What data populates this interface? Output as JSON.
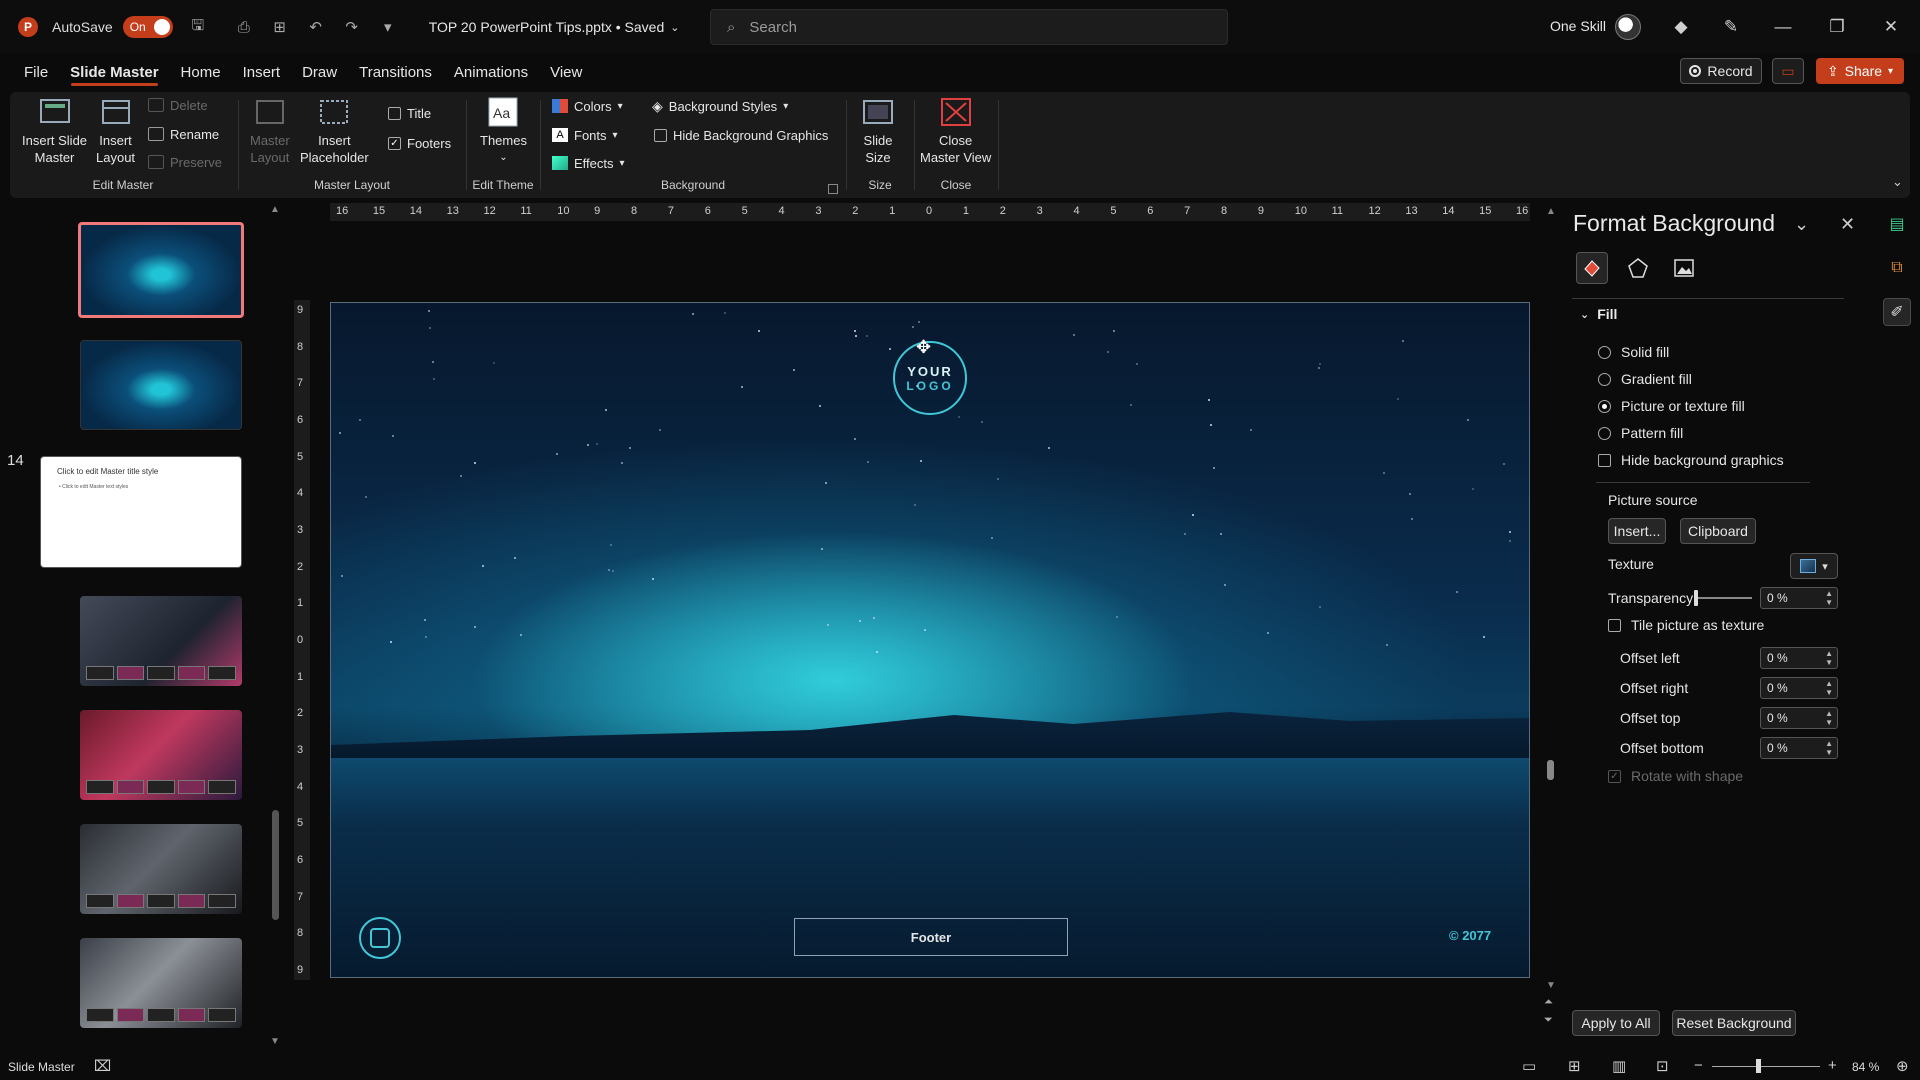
{
  "titlebar": {
    "app_initial": "P",
    "autosave_label": "AutoSave",
    "autosave_state": "On",
    "document_title": "TOP 20 PowerPoint Tips.pptx • Saved",
    "search_placeholder": "Search",
    "user_name": "One Skill"
  },
  "menu": {
    "tabs": [
      "File",
      "Slide Master",
      "Home",
      "Insert",
      "Draw",
      "Transitions",
      "Animations",
      "View"
    ],
    "active_tab": "Slide Master",
    "record_label": "Record",
    "share_label": "Share"
  },
  "ribbon": {
    "edit_master": {
      "label": "Edit Master",
      "insert_slide_master": "Insert Slide Master",
      "insert_slide_master_l1": "Insert Slide",
      "insert_slide_master_l2": "Master",
      "insert_layout_l1": "Insert",
      "insert_layout_l2": "Layout",
      "delete": "Delete",
      "rename": "Rename",
      "preserve": "Preserve"
    },
    "master_layout": {
      "label": "Master Layout",
      "master_layout_l1": "Master",
      "master_layout_l2": "Layout",
      "insert_placeholder_l1": "Insert",
      "insert_placeholder_l2": "Placeholder",
      "title_checkbox": "Title",
      "footers_checkbox": "Footers"
    },
    "edit_theme": {
      "label": "Edit Theme",
      "themes": "Themes"
    },
    "background": {
      "label": "Background",
      "colors": "Colors",
      "fonts": "Fonts",
      "effects": "Effects",
      "background_styles": "Background Styles",
      "hide_background_graphics": "Hide Background Graphics"
    },
    "size": {
      "label": "Size",
      "slide_size_l1": "Slide",
      "slide_size_l2": "Size"
    },
    "close": {
      "label": "Close",
      "close_master_view_l1": "Close",
      "close_master_view_l2": "Master View"
    }
  },
  "thumbnails": {
    "slide_number": "14",
    "white_title": "Click to edit Master title style",
    "white_body": "• Click to edit Master text styles"
  },
  "slide": {
    "logo_line1": "YOUR",
    "logo_line2": "LOGO",
    "footer": "Footer",
    "copyright": "© 2077"
  },
  "rulers": {
    "horizontal": [
      "16",
      "15",
      "14",
      "13",
      "12",
      "11",
      "10",
      "9",
      "8",
      "7",
      "6",
      "5",
      "4",
      "3",
      "2",
      "1",
      "0",
      "1",
      "2",
      "3",
      "4",
      "5",
      "6",
      "7",
      "8",
      "9",
      "10",
      "11",
      "12",
      "13",
      "14",
      "15",
      "16"
    ],
    "vertical": [
      "9",
      "8",
      "7",
      "6",
      "5",
      "4",
      "3",
      "2",
      "1",
      "0",
      "1",
      "2",
      "3",
      "4",
      "5",
      "6",
      "7",
      "8",
      "9"
    ]
  },
  "format_background": {
    "title": "Format Background",
    "fill_section": "Fill",
    "fill_options": [
      "Solid fill",
      "Gradient fill",
      "Picture or texture fill",
      "Pattern fill"
    ],
    "selected_fill": "Picture or texture fill",
    "hide_background_graphics": "Hide background graphics",
    "picture_source": "Picture source",
    "insert_button": "Insert...",
    "clipboard_button": "Clipboard",
    "texture_label": "Texture",
    "transparency_label": "Transparency",
    "transparency_value": "0 %",
    "tile_picture": "Tile picture as texture",
    "offset_left_label": "Offset left",
    "offset_left_value": "0 %",
    "offset_right_label": "Offset right",
    "offset_right_value": "0 %",
    "offset_top_label": "Offset top",
    "offset_top_value": "0 %",
    "offset_bottom_label": "Offset bottom",
    "offset_bottom_value": "0 %",
    "rotate_with_shape": "Rotate with shape",
    "apply_to_all": "Apply to All",
    "reset_background": "Reset Background"
  },
  "statusbar": {
    "mode": "Slide Master",
    "zoom": "84 %"
  },
  "colors": {
    "accent": "#c43e1c",
    "logo_cyan": "#3fc7d8",
    "selection": "#f07a7a"
  }
}
